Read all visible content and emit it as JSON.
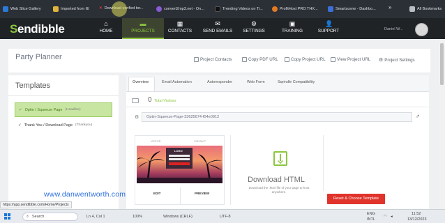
{
  "bookmarks": [
    {
      "label": "Web Slice Gallery",
      "color": "#2a7bd8"
    },
    {
      "label": "Imported from IE",
      "color": "#e0b43c"
    },
    {
      "label": "Download verified tor...",
      "color": "#e23b3b"
    },
    {
      "label": "convert2mp3.net - On...",
      "color": "#8a5bd6"
    },
    {
      "label": "Trending Videos on Ti...",
      "color": "#111111"
    },
    {
      "label": "ProfitHost PRO THX...",
      "color": "#e07a22"
    },
    {
      "label": "Smartscene - Dashbo...",
      "color": "#3c6fd8"
    }
  ],
  "bookmarks_more": "»",
  "all_bookmarks": "All Bookmarks",
  "brand": {
    "s": "S",
    "rest": "endibble"
  },
  "nav": [
    {
      "label": "HOME",
      "icon": "⌂"
    },
    {
      "label": "PROJECTS",
      "icon": "▬"
    },
    {
      "label": "CONTACTS",
      "icon": "▦"
    },
    {
      "label": "SEND EMAILS",
      "icon": "✉"
    },
    {
      "label": "SETTINGS",
      "icon": "⚙"
    },
    {
      "label": "TRAINING",
      "icon": "▣"
    },
    {
      "label": "SUPPORT",
      "icon": "👤"
    }
  ],
  "user_name": "Daniel W...",
  "project": {
    "title": "Party Planner",
    "links": [
      "Project Contacts",
      "Copy PDF URL",
      "Copy Project URL",
      "View Project URL",
      "Project Settings"
    ]
  },
  "templates": {
    "title": "Templates",
    "items": [
      {
        "label": "Optin / Squeeze Page",
        "sub": "(Headline)"
      },
      {
        "label": "Thank You / Download Page",
        "sub": "(Thankyou)"
      }
    ]
  },
  "tabs": [
    "Overview",
    "Email Automation",
    "Autoresponder",
    "Web Form",
    "Sqrindle Compatibility"
  ],
  "stats": {
    "count": "0",
    "label": "Total Visitors"
  },
  "page_url": "Optin-Squeeze-Page-33625674-f04e0912",
  "preview": {
    "visitor": "VISITOR",
    "contact": "CONTACT",
    "logo": "LOGO",
    "edit": "EDIT",
    "preview": "PREVIEW"
  },
  "download": {
    "title": "Download HTML",
    "sub": "Download the .html file of your page to host anywhere."
  },
  "reset_button": "Reset & Choose Template",
  "url_hint": "https://app.sendibble.com/Home/Projects",
  "watermark": "www.danwentworth.com",
  "statusbar": {
    "search": "Search",
    "pos": "Ln 4, Col 1",
    "zoom": "100%",
    "eol": "Windows (CRLF)",
    "enc": "UTF-8",
    "lang": "ENG",
    "region": "INTL",
    "time": "11:52",
    "date": "13/12/2023"
  },
  "colors": {
    "accent": "#8dc63f",
    "reset": "#e0332b",
    "nav_bg": "#1f2326"
  }
}
